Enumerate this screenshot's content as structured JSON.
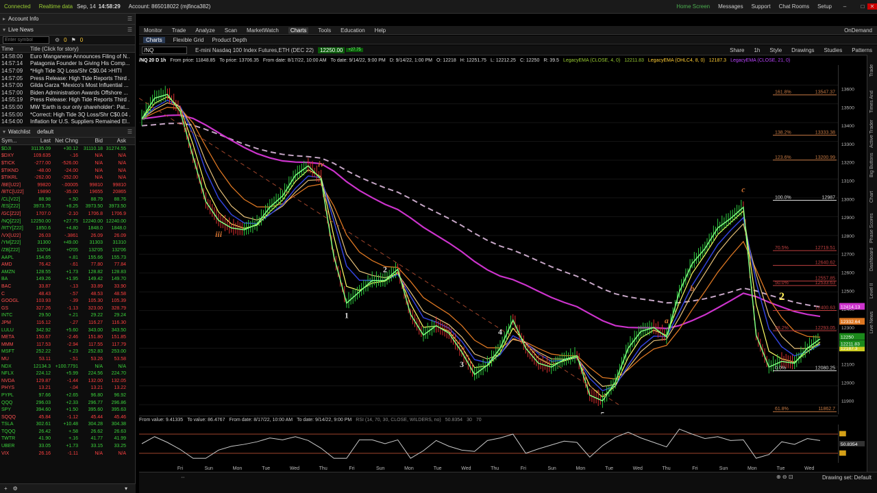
{
  "topbar": {
    "connected": "Connected",
    "realtime": "Realtime data",
    "datetime": "Sep, 14",
    "time": "14:58:29",
    "account": "Account: 865018022 (mjfinca382)",
    "home": "Home Screen",
    "messages": "Messages",
    "support": "Support",
    "chatrooms": "Chat Rooms",
    "setup": "Setup"
  },
  "left": {
    "account_info": "Account Info",
    "live_news": "Live News",
    "enter_symbol": "Enter symbol",
    "news_cols": [
      "Time",
      "Title (Click for story)"
    ],
    "news": [
      {
        "t": "14:58:00",
        "s": "Euro Manganese Announces Filing of N..."
      },
      {
        "t": "14:57:14",
        "s": "Patagonia Founder Is Giving His Comp..."
      },
      {
        "t": "14:57:09",
        "s": "*High Tide 3Q Loss/Shr C$0.04 >HITI"
      },
      {
        "t": "14:57:05",
        "s": "Press Release: High Tide Reports Third ..."
      },
      {
        "t": "14:57:00",
        "s": "Gilda Garza \"Mexico's Most Influential ..."
      },
      {
        "t": "14:57:00",
        "s": "Biden Administration Awards Offshore ..."
      },
      {
        "t": "14:55:19",
        "s": "Press Release: High Tide Reports Third ..."
      },
      {
        "t": "14:55:00",
        "s": "MW 'Earth is our only shareholder': Pat..."
      },
      {
        "t": "14:55:00",
        "s": "*Correct: High Tide 3Q Loss/Shr C$0.04 ..."
      },
      {
        "t": "14:54:00",
        "s": "Inflation for U.S. Suppliers Remained El..."
      }
    ],
    "watchlist": "Watchlist",
    "wl_name": "default",
    "wl_cols": [
      "Sym...",
      "Last",
      "Net Chng",
      "Bid",
      "Ask"
    ],
    "rows": [
      {
        "s": "$DJI",
        "l": "31135.09",
        "c": "+30.12",
        "b": "31110.18",
        "a": "31274.55",
        "d": "up"
      },
      {
        "s": "$DXY",
        "l": "109.635",
        "c": "-.16",
        "b": "N/A",
        "a": "N/A",
        "d": "dn"
      },
      {
        "s": "$TICK",
        "l": "-277.00",
        "c": "-526.00",
        "b": "N/A",
        "a": "N/A",
        "d": "dn"
      },
      {
        "s": "$TIKND",
        "l": "-48.00",
        "c": "-24.00",
        "b": "N/A",
        "a": "N/A",
        "d": "dn"
      },
      {
        "s": "$TIKRL",
        "l": "-262.00",
        "c": "-252.00",
        "b": "N/A",
        "a": "N/A",
        "d": "dn"
      },
      {
        "s": "/BE[U22]",
        "l": "99820",
        "c": "-.00005",
        "b": "99810",
        "a": "99810",
        "d": "dn"
      },
      {
        "s": "/BTC[U22]",
        "l": "19890",
        "c": "-35.00",
        "b": "19655",
        "a": "20865",
        "d": "dn"
      },
      {
        "s": "/CL[V22]",
        "l": "88.98",
        "c": "+.50",
        "b": "88.79",
        "a": "88.76",
        "d": "up"
      },
      {
        "s": "/ES[Z22]",
        "l": "3973.75",
        "c": "+8.25",
        "b": "3973.50",
        "a": "3973.50",
        "d": "up"
      },
      {
        "s": "/GC[Z22]",
        "l": "1707.0",
        "c": "-2.10",
        "b": "1706.8",
        "a": "1706.9",
        "d": "dn"
      },
      {
        "s": "/NQ[Z22]",
        "l": "12250.00",
        "c": "+27.75",
        "b": "12240.00",
        "a": "12240.00",
        "d": "up"
      },
      {
        "s": "/RTY[Z22]",
        "l": "1850.6",
        "c": "+4.80",
        "b": "1848.0",
        "a": "1848.0",
        "d": "up"
      },
      {
        "s": "/VX[U22]",
        "l": "26.03",
        "c": "-.3861",
        "b": "26.09",
        "a": "26.09",
        "d": "dn"
      },
      {
        "s": "/YM[Z22]",
        "l": "31300",
        "c": "+49.00",
        "b": "31303",
        "a": "31310",
        "d": "up"
      },
      {
        "s": "/ZB[Z22]",
        "l": "132'04",
        "c": "+0'05",
        "b": "132'05",
        "a": "132'06",
        "d": "up"
      },
      {
        "s": "AAPL",
        "l": "154.65",
        "c": "+.81",
        "b": "155.66",
        "a": "155.73",
        "d": "up"
      },
      {
        "s": "AMD",
        "l": "76.42",
        "c": "-.61",
        "b": "77.80",
        "a": "77.84",
        "d": "dn"
      },
      {
        "s": "AMZN",
        "l": "128.55",
        "c": "+1.73",
        "b": "128.82",
        "a": "128.83",
        "d": "up"
      },
      {
        "s": "BA",
        "l": "149.26",
        "c": "+1.95",
        "b": "149.42",
        "a": "149.70",
        "d": "up"
      },
      {
        "s": "BAC",
        "l": "33.87",
        "c": "-.13",
        "b": "33.89",
        "a": "33.90",
        "d": "dn"
      },
      {
        "s": "C",
        "l": "48.43",
        "c": "-.57",
        "b": "48.53",
        "a": "48.58",
        "d": "dn"
      },
      {
        "s": "GOOGL",
        "l": "103.93",
        "c": "-.39",
        "b": "105.30",
        "a": "105.39",
        "d": "dn"
      },
      {
        "s": "GS",
        "l": "327.26",
        "c": "-1.13",
        "b": "323.00",
        "a": "328.79",
        "d": "dn"
      },
      {
        "s": "INTC",
        "l": "29.50",
        "c": "+.21",
        "b": "29.22",
        "a": "29.24",
        "d": "up"
      },
      {
        "s": "JPM",
        "l": "116.12",
        "c": "-.27",
        "b": "116.27",
        "a": "116.30",
        "d": "dn"
      },
      {
        "s": "LULU",
        "l": "342.92",
        "c": "+5.60",
        "b": "343.00",
        "a": "343.50",
        "d": "up"
      },
      {
        "s": "META",
        "l": "150.67",
        "c": "-2.46",
        "b": "151.80",
        "a": "151.85",
        "d": "dn"
      },
      {
        "s": "MMM",
        "l": "117.53",
        "c": "-2.94",
        "b": "117.55",
        "a": "117.79",
        "d": "dn"
      },
      {
        "s": "MSFT",
        "l": "252.22",
        "c": "+.23",
        "b": "252.83",
        "a": "253.00",
        "d": "up"
      },
      {
        "s": "MU",
        "l": "53.11",
        "c": "-.51",
        "b": "53.26",
        "a": "53.58",
        "d": "dn"
      },
      {
        "s": "NDX",
        "l": "12134.3",
        "c": "+100.7791",
        "b": "N/A",
        "a": "N/A",
        "d": "up"
      },
      {
        "s": "NFLX",
        "l": "224.12",
        "c": "+5.99",
        "b": "224.56",
        "a": "224.70",
        "d": "up"
      },
      {
        "s": "NVDA",
        "l": "129.87",
        "c": "-1.44",
        "b": "132.00",
        "a": "132.05",
        "d": "dn"
      },
      {
        "s": "PHYS",
        "l": "13.21",
        "c": "-.04",
        "b": "13.21",
        "a": "13.22",
        "d": "dn"
      },
      {
        "s": "PYPL",
        "l": "97.66",
        "c": "+2.65",
        "b": "96.80",
        "a": "96.92",
        "d": "up"
      },
      {
        "s": "QQQ",
        "l": "296.03",
        "c": "+2.33",
        "b": "296.77",
        "a": "296.86",
        "d": "up"
      },
      {
        "s": "SPY",
        "l": "394.60",
        "c": "+1.50",
        "b": "395.60",
        "a": "395.63",
        "d": "up"
      },
      {
        "s": "SQQQ",
        "l": "45.84",
        "c": "-1.12",
        "b": "45.44",
        "a": "45.46",
        "d": "dn"
      },
      {
        "s": "TSLA",
        "l": "302.61",
        "c": "+10.48",
        "b": "304.28",
        "a": "304.38",
        "d": "up"
      },
      {
        "s": "TQQQ",
        "l": "26.42",
        "c": "+.58",
        "b": "26.62",
        "a": "26.63",
        "d": "up"
      },
      {
        "s": "TWTR",
        "l": "41.90",
        "c": "+.16",
        "b": "41.77",
        "a": "41.99",
        "d": "up"
      },
      {
        "s": "UBER",
        "l": "33.05",
        "c": "+1.73",
        "b": "33.15",
        "a": "33.25",
        "d": "up"
      },
      {
        "s": "VIX",
        "l": "26.16",
        "c": "-1.11",
        "b": "N/A",
        "a": "N/A",
        "d": "dn"
      }
    ]
  },
  "menu": {
    "items": [
      "Monitor",
      "Trade",
      "Analyze",
      "Scan",
      "MarketWatch",
      "Charts",
      "Tools",
      "Education",
      "Help"
    ],
    "active": "Charts",
    "ondemand": "OnDemand"
  },
  "subtabs": {
    "items": [
      "Charts",
      "Flexible Grid",
      "Product Depth"
    ]
  },
  "symbolbar": {
    "symbol": "/NQ",
    "desc": "E-mini Nasdaq 100 Index Futures,ETH (DEC 22)",
    "price": "12250.00",
    "chg": "+27.75",
    "timeframe": "1h",
    "tools": [
      "Share",
      "Style",
      "Drawings",
      "Studies",
      "Patterns"
    ]
  },
  "infobar": {
    "title": "/NQ 20 D 1h",
    "from_price": "From price: 11848.85",
    "to_price": "To price: 13706.35",
    "from_date": "From date: 8/17/22, 10:00 AM",
    "to_date": "To date: 9/14/22, 9:00 PM",
    "d": "D: 9/14/22, 1:00 PM",
    "o": "O: 12218",
    "h": "H: 12251.75",
    "l": "L: 12212.25",
    "c": "C: 12250",
    "r": "R: 39.5",
    "ema1": "LegacyEMA (CLOSE, 4, 0)",
    "ema1_val": "12211.83",
    "ema2": "LegacyEMA (OHLC4, 8, 0)",
    "ema2_val": "12187.3",
    "ema3": "LegacyEMA (CLOSE, 21, 0)"
  },
  "rsi_info": {
    "from_value": "From value: 9.41335",
    "to_value": "To value: 86.4767",
    "from_date": "From date: 8/17/22, 10:00 AM",
    "to_date": "To date: 9/14/22, 9:00 PM",
    "study": "RSI (14, 70, 30, CLOSE, WILDERS, no)",
    "val": "50.8354",
    "ob": "30",
    "os": "70"
  },
  "chart_data": {
    "type": "line",
    "title": "/NQ 20 D 1h",
    "ylim": [
      11848.85,
      13706.35
    ],
    "y_ticks": [
      13600,
      13500,
      13400,
      13300,
      13200,
      13100,
      13000,
      12900,
      12800,
      12700,
      12600,
      12500,
      12400,
      12300,
      12200,
      12100,
      12000,
      11900
    ],
    "x_ticks": [
      "Fri",
      "Sun",
      "Mon",
      "Tue",
      "Wed",
      "Thu",
      "Fri",
      "Sun",
      "Mon",
      "Tue",
      "Wed",
      "Thu",
      "Fri",
      "Sun",
      "Mon",
      "Tue",
      "Wed",
      "Thu",
      "Fri",
      "Sun",
      "Mon",
      "Tue",
      "Wed"
    ],
    "price_series": [
      13420,
      13530,
      13550,
      13460,
      13220,
      12980,
      12880,
      12840,
      12830,
      12860,
      12950,
      13010,
      13120,
      13170,
      13100,
      12690,
      12440,
      12500,
      12560,
      12560,
      12620,
      12380,
      12270,
      12320,
      12280,
      12180,
      12060,
      12110,
      12200,
      12350,
      12200,
      12120,
      12100,
      12140,
      12160,
      11950,
      11920,
      12020,
      12200,
      12290,
      12310,
      12260,
      12500,
      12650,
      12730,
      12840,
      12890,
      12950,
      12270,
      12100,
      12130,
      12120,
      12200,
      12250
    ],
    "fib_levels": [
      {
        "pct": "161.8%",
        "price": "13547.37"
      },
      {
        "pct": "138.2%",
        "price": "13333.38"
      },
      {
        "pct": "123.6%",
        "price": "13200.99"
      },
      {
        "pct": "100.0%",
        "price": "12987"
      },
      {
        "pct": "70.5%",
        "price": "12719.51"
      },
      {
        "pct": "",
        "price": "12640.62"
      },
      {
        "pct": "",
        "price": "12557.85"
      },
      {
        "pct": "50.0%",
        "price": "12533.63"
      },
      {
        "pct": "",
        "price": "12400.63"
      },
      {
        "pct": "38.2%",
        "price": "12293.05"
      },
      {
        "pct": "0.0%",
        "price": "12080.25"
      },
      {
        "pct": "61.8%",
        "price": "11862.7"
      }
    ],
    "wave_labels": [
      "iv",
      "iii",
      "2",
      "1",
      "4",
      "3",
      "5",
      "a",
      "b",
      "c",
      "2"
    ],
    "scale_marks": [
      {
        "label": "12414.13",
        "color": "#cc33cc"
      },
      {
        "label": "12332.64",
        "color": "#dd7722"
      },
      {
        "label": "12250",
        "color": "#1b8a1b"
      },
      {
        "label": "12187.3",
        "color": "#cccc22"
      },
      {
        "label": "12211.83",
        "color": "#1b8a1b"
      }
    ]
  },
  "sidetabs": [
    "Trade",
    "Times And Sales",
    "Active Trader",
    "Big Buttons",
    "Chart",
    "Phase Scores",
    "Dashboard",
    "Level II",
    "Live News"
  ],
  "bottom": {
    "drawing_set": "Drawing set: Default"
  }
}
